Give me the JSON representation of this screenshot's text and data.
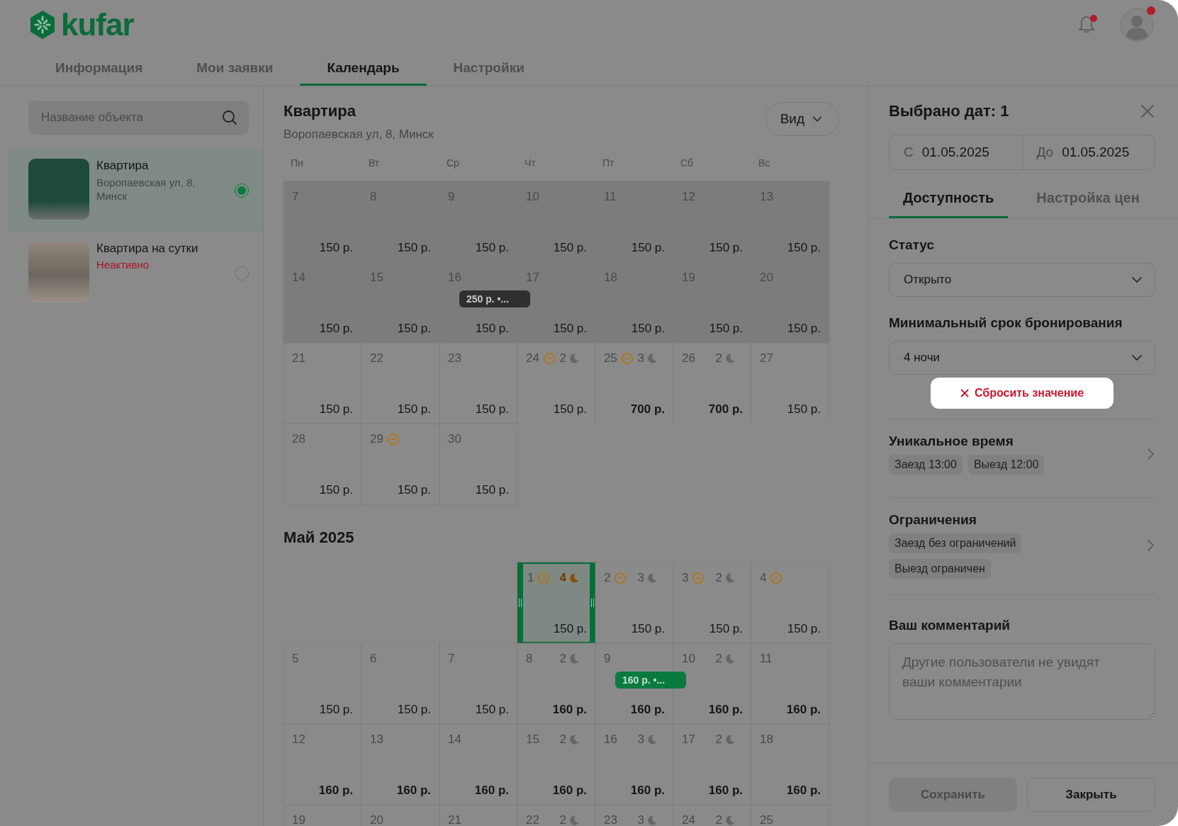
{
  "header": {
    "logo": "kufar",
    "notifications_unread": true,
    "profile_unread": true,
    "tabs": [
      {
        "label": "Информация",
        "selected": false
      },
      {
        "label": "Мои заявки",
        "selected": false
      },
      {
        "label": "Календарь",
        "selected": true
      },
      {
        "label": "Настройки",
        "selected": false
      }
    ]
  },
  "sidebar": {
    "search": {
      "placeholder": "Название объекта"
    },
    "objects": [
      {
        "name": "Квартира",
        "address": "Воропаевская ул, 8, Минск",
        "selected": true
      },
      {
        "name": "Квартира на сутки",
        "status": "Неактивно",
        "selected": false
      }
    ]
  },
  "calendar": {
    "title": "Квартира",
    "address": "Воропаевская ул, 8, Минск",
    "view_button": "Вид",
    "weekdays": [
      "Пн",
      "Вт",
      "Ср",
      "Чт",
      "Пт",
      "Сб",
      "Вс"
    ],
    "months": [
      {
        "weeks": [
          {
            "days": [
              {
                "day": "7",
                "price": "150 р.",
                "past": true,
                "bold": false,
                "restricted": false,
                "selected": false
              },
              {
                "day": "8",
                "price": "150 р.",
                "past": true,
                "bold": false,
                "restricted": false,
                "selected": false
              },
              {
                "day": "9",
                "price": "150 р.",
                "past": true,
                "bold": false,
                "restricted": false,
                "selected": false
              },
              {
                "day": "10",
                "price": "150 р.",
                "past": true,
                "bold": false,
                "restricted": false,
                "selected": false
              },
              {
                "day": "11",
                "price": "150 р.",
                "past": true,
                "bold": false,
                "restricted": false,
                "selected": false
              },
              {
                "day": "12",
                "price": "150 р.",
                "past": true,
                "bold": false,
                "restricted": false,
                "selected": false
              },
              {
                "day": "13",
                "price": "150 р.",
                "past": true,
                "bold": false,
                "restricted": false,
                "selected": false
              }
            ]
          },
          {
            "days": [
              {
                "day": "14",
                "price": "150 р.",
                "past": true,
                "bold": false,
                "restricted": false,
                "selected": false
              },
              {
                "day": "15",
                "price": "150 р.",
                "past": true,
                "bold": false,
                "restricted": false,
                "selected": false
              },
              {
                "day": "16",
                "price": "150 р.",
                "past": true,
                "bold": false,
                "restricted": false,
                "selected": false,
                "tag": {
                  "text": "250 р. •...",
                  "kind": "dark"
                }
              },
              {
                "day": "17",
                "price": "150 р.",
                "past": true,
                "bold": false,
                "restricted": false,
                "selected": false
              },
              {
                "day": "18",
                "price": "150 р.",
                "past": true,
                "bold": false,
                "restricted": false,
                "selected": false
              },
              {
                "day": "19",
                "price": "150 р.",
                "past": true,
                "bold": false,
                "restricted": false,
                "selected": false
              },
              {
                "day": "20",
                "price": "150 р.",
                "past": true,
                "bold": false,
                "restricted": false,
                "selected": false
              }
            ]
          },
          {
            "days": [
              {
                "day": "21",
                "price": "150 р.",
                "past": false,
                "bold": false,
                "restricted": false,
                "selected": false
              },
              {
                "day": "22",
                "price": "150 р.",
                "past": false,
                "bold": false,
                "restricted": false,
                "selected": false
              },
              {
                "day": "23",
                "price": "150 р.",
                "past": false,
                "bold": false,
                "restricted": false,
                "selected": false
              },
              {
                "day": "24",
                "price": "150 р.",
                "past": false,
                "bold": false,
                "restricted": true,
                "selected": false,
                "nights": "2"
              },
              {
                "day": "25",
                "price": "700 р.",
                "past": false,
                "bold": true,
                "restricted": true,
                "selected": false,
                "nights": "3"
              },
              {
                "day": "26",
                "price": "700 р.",
                "past": false,
                "bold": true,
                "restricted": false,
                "selected": false,
                "nights": "2"
              },
              {
                "day": "27",
                "price": "150 р.",
                "past": false,
                "bold": false,
                "restricted": false,
                "selected": false
              }
            ]
          },
          {
            "days": [
              {
                "day": "28",
                "price": "150 р.",
                "past": false,
                "bold": false,
                "restricted": false,
                "selected": false
              },
              {
                "day": "29",
                "price": "150 р.",
                "past": false,
                "bold": false,
                "restricted": true,
                "selected": false
              },
              {
                "day": "30",
                "price": "150 р.",
                "past": false,
                "bold": false,
                "restricted": false,
                "selected": false
              }
            ]
          }
        ]
      },
      {
        "title": "Май 2025",
        "weeks": [
          {
            "days": [
              {
                "kind": "blank"
              },
              {
                "kind": "blank"
              },
              {
                "kind": "blank"
              },
              {
                "kind": "day",
                "day": "1",
                "price": "150 р.",
                "past": false,
                "bold": false,
                "restricted": true,
                "selected": true,
                "nights": "4",
                "nights_warning": true
              },
              {
                "kind": "day",
                "day": "2",
                "price": "150 р.",
                "past": false,
                "bold": false,
                "restricted": true,
                "selected": false,
                "nights": "3"
              },
              {
                "kind": "day",
                "day": "3",
                "price": "150 р.",
                "past": false,
                "bold": false,
                "restricted": true,
                "selected": false,
                "nights": "2"
              },
              {
                "kind": "day",
                "day": "4",
                "price": "150 р.",
                "past": false,
                "bold": false,
                "restricted": true,
                "selected": false
              }
            ]
          },
          {
            "days": [
              {
                "day": "5",
                "price": "150 р.",
                "past": false,
                "bold": false,
                "restricted": false,
                "selected": false
              },
              {
                "day": "6",
                "price": "150 р.",
                "past": false,
                "bold": false,
                "restricted": false,
                "selected": false
              },
              {
                "day": "7",
                "price": "150 р.",
                "past": false,
                "bold": false,
                "restricted": false,
                "selected": false
              },
              {
                "day": "8",
                "price": "160 р.",
                "past": false,
                "bold": true,
                "restricted": false,
                "selected": false,
                "nights": "2"
              },
              {
                "day": "9",
                "price": "160 р.",
                "past": false,
                "bold": true,
                "restricted": false,
                "selected": false,
                "tag": {
                  "text": "160 р. •...",
                  "kind": "green"
                }
              },
              {
                "day": "10",
                "price": "160 р.",
                "past": false,
                "bold": true,
                "restricted": false,
                "selected": false,
                "nights": "2"
              },
              {
                "day": "11",
                "price": "160 р.",
                "past": false,
                "bold": true,
                "restricted": false,
                "selected": false
              }
            ]
          },
          {
            "days": [
              {
                "day": "12",
                "price": "160 р.",
                "past": false,
                "bold": true,
                "restricted": false,
                "selected": false
              },
              {
                "day": "13",
                "price": "160 р.",
                "past": false,
                "bold": true,
                "restricted": false,
                "selected": false
              },
              {
                "day": "14",
                "price": "160 р.",
                "past": false,
                "bold": true,
                "restricted": false,
                "selected": false
              },
              {
                "day": "15",
                "price": "160 р.",
                "past": false,
                "bold": true,
                "restricted": false,
                "selected": false,
                "nights": "2"
              },
              {
                "day": "16",
                "price": "160 р.",
                "past": false,
                "bold": true,
                "restricted": false,
                "selected": false,
                "nights": "3"
              },
              {
                "day": "17",
                "price": "160 р.",
                "past": false,
                "bold": true,
                "restricted": false,
                "selected": false,
                "nights": "2"
              },
              {
                "day": "18",
                "price": "160 р.",
                "past": false,
                "bold": true,
                "restricted": false,
                "selected": false
              }
            ]
          },
          {
            "days": [
              {
                "day": "19",
                "past": false,
                "restricted": false,
                "selected": false
              },
              {
                "day": "20",
                "past": false,
                "restricted": false,
                "selected": false
              },
              {
                "day": "21",
                "past": false,
                "restricted": false,
                "selected": false
              },
              {
                "day": "22",
                "past": false,
                "restricted": false,
                "selected": false,
                "nights": "2"
              },
              {
                "day": "23",
                "past": false,
                "restricted": false,
                "selected": false,
                "nights": "3"
              },
              {
                "day": "24",
                "past": false,
                "restricted": false,
                "selected": false,
                "nights": "2"
              },
              {
                "day": "25",
                "past": false,
                "restricted": false,
                "selected": false
              }
            ]
          }
        ]
      }
    ]
  },
  "panel": {
    "title": "Выбрано дат: 1",
    "range": {
      "from_label": "С",
      "from": "01.05.2025",
      "to_label": "До",
      "to": "01.05.2025"
    },
    "tabs": [
      {
        "label": "Доступность",
        "selected": true
      },
      {
        "label": "Настройка цен",
        "selected": false
      }
    ],
    "status": {
      "label": "Статус",
      "value": "Открыто"
    },
    "min_stay": {
      "label": "Минимальный срок бронирования",
      "value": "4 ночи",
      "reset": "Сбросить значение",
      "reset_highlighted": true
    },
    "sections": [
      {
        "title": "Уникальное время",
        "chips": [
          "Заезд 13:00",
          "Выезд 12:00"
        ],
        "chips_inline": true
      },
      {
        "title": "Ограничения",
        "chips": [
          "Заезд без ограничений",
          "Выезд ограничен"
        ],
        "chips_inline": false
      }
    ],
    "comment": {
      "label": "Ваш комментарий",
      "placeholder": "Другие пользователи не увидят ваши комментарии"
    },
    "buttons": [
      {
        "label": "Сохранить",
        "disabled": true
      },
      {
        "label": "Закрыть",
        "disabled": false
      }
    ]
  }
}
